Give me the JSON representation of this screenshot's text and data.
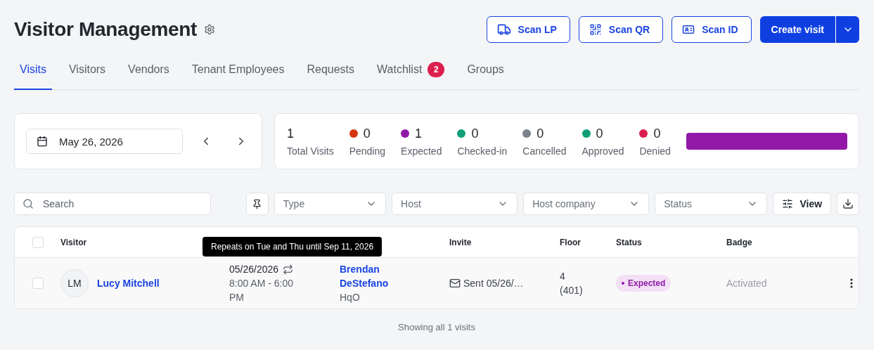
{
  "header": {
    "title": "Visitor Management",
    "actions": [
      {
        "kind": "truck",
        "label": "Scan LP"
      },
      {
        "kind": "qr",
        "label": "Scan QR"
      },
      {
        "kind": "id",
        "label": "Scan ID"
      }
    ],
    "primary": "Create visit"
  },
  "tabs": [
    {
      "label": "Visits",
      "selected": true
    },
    {
      "label": "Visitors",
      "selected": false
    },
    {
      "label": "Vendors",
      "selected": false
    },
    {
      "label": "Tenant Employees",
      "selected": false
    },
    {
      "label": "Requests",
      "selected": false
    },
    {
      "label": "Watchlist",
      "selected": false,
      "badge": "2"
    },
    {
      "label": "Groups",
      "selected": false
    }
  ],
  "date": "May 26, 2026",
  "stats": [
    {
      "value": "1",
      "label": "Total Visits"
    },
    {
      "value": "0",
      "label": "Pending",
      "color": "#d4350f"
    },
    {
      "value": "1",
      "label": "Expected",
      "color": "#9219a8"
    },
    {
      "value": "0",
      "label": "Checked-in",
      "color": "#0e9f77"
    },
    {
      "value": "0",
      "label": "Cancelled",
      "color": "#7b818c"
    },
    {
      "value": "0",
      "label": "Approved",
      "color": "#0e9f77"
    },
    {
      "value": "0",
      "label": "Denied",
      "color": "#dc1f4f"
    }
  ],
  "filters": {
    "search_placeholder": "Search",
    "selects": [
      "Type",
      "Host",
      "Host company",
      "Status"
    ],
    "view": "View"
  },
  "table": {
    "all_checked": false,
    "columns": [
      "Visitor",
      "",
      "",
      "Invite",
      "Floor",
      "Status",
      "Badge"
    ],
    "tooltip": "Repeats on Tue and Thu until Sep 11, 2026",
    "rows": [
      {
        "checked": false,
        "initials": "LM",
        "visitor": "Lucy Mitchell",
        "date": "05/26/2026",
        "time": "8:00 AM - 6:00 PM",
        "repeats": true,
        "host": "Brendan DeStefano",
        "company": "HqO",
        "invite": "Sent 05/26/…",
        "floor": "4 (401)",
        "status": "Expected",
        "badge": "Activated"
      }
    ]
  },
  "footer": "Showing all 1 visits"
}
